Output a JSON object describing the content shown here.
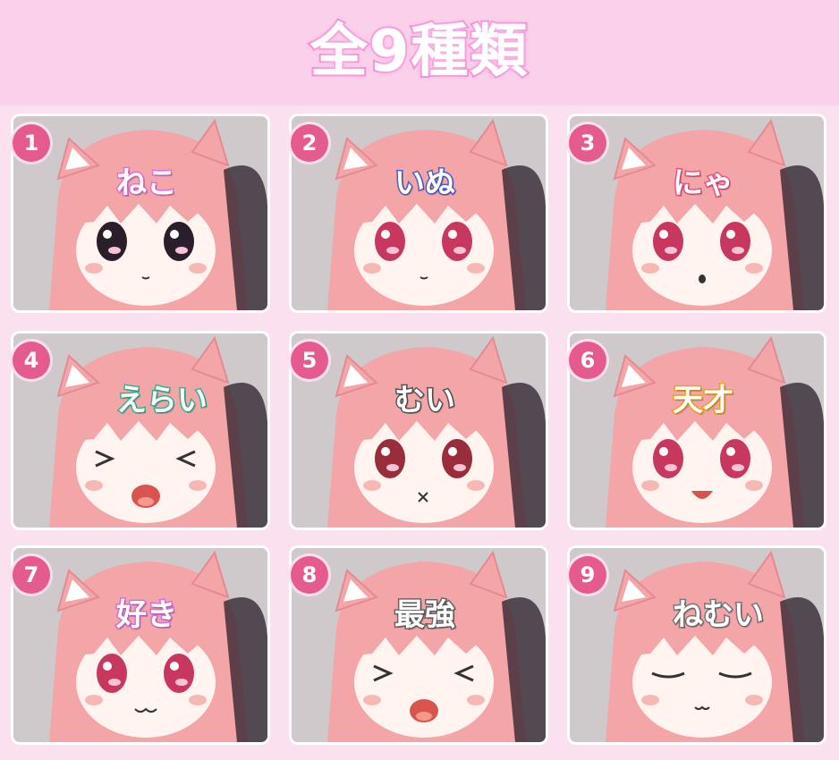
{
  "title": "全9種類",
  "items": [
    {
      "num": "1",
      "word": "ねこ",
      "color": "#e070d8",
      "expression": "dark-eyes"
    },
    {
      "num": "2",
      "word": "いぬ",
      "color": "#4a5fd0",
      "expression": "pink-eyes"
    },
    {
      "num": "3",
      "word": "にゃ",
      "color": "#f05080",
      "expression": "surprised"
    },
    {
      "num": "4",
      "word": "えらい",
      "color": "#2fb890",
      "expression": "happy-open"
    },
    {
      "num": "5",
      "word": "むい",
      "color": "#555555",
      "expression": "teary"
    },
    {
      "num": "6",
      "word": "天才",
      "color": "#e8a020",
      "expression": "smile-open"
    },
    {
      "num": "7",
      "word": "好き",
      "color": "#d070d8",
      "expression": "cat-mouth"
    },
    {
      "num": "8",
      "word": "最強",
      "color": "#666666",
      "expression": "happy-open"
    },
    {
      "num": "9",
      "word": "ねむい",
      "color": "#777777",
      "expression": "sleepy"
    }
  ]
}
